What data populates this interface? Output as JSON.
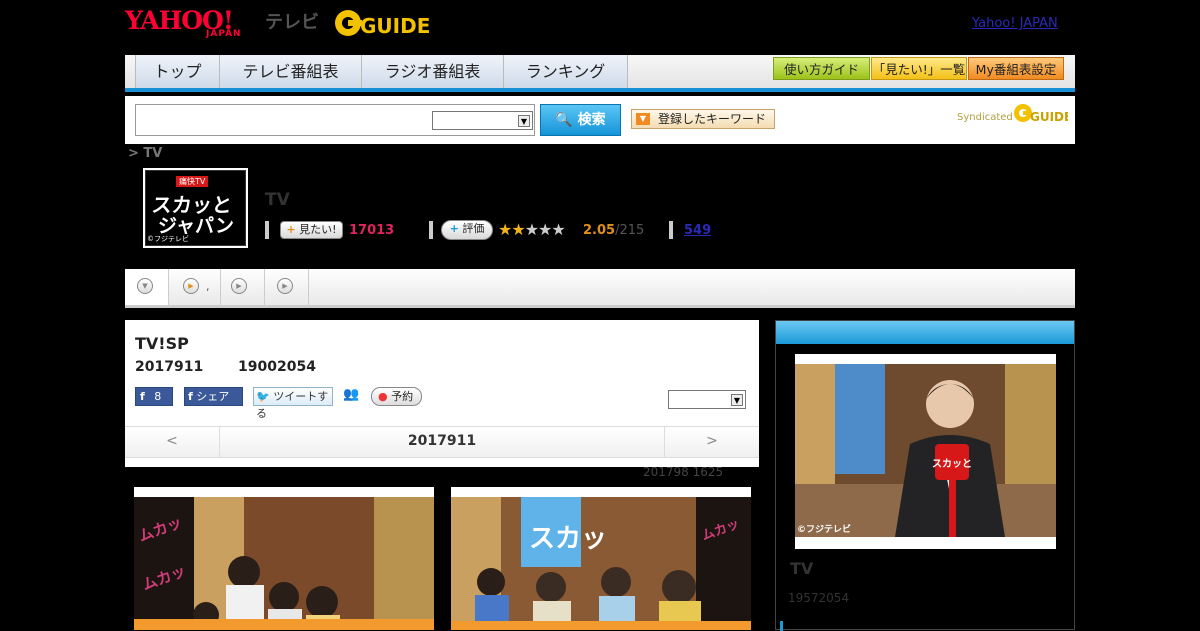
{
  "header": {
    "yahoo_logo": "YAHOO!",
    "japan_logo": "JAPAN",
    "tv_label": "テレビ",
    "gguide_logo": "GUIDE",
    "yahoo_japan_link": "Yahoo! JAPAN"
  },
  "nav": {
    "tabs": [
      "トップ",
      "テレビ番組表",
      "ラジオ番組表",
      "ランキング"
    ],
    "guide_button": "使い方ガイド",
    "mitai_list_button": "「見たい!」一覧",
    "my_settings_button": "My番組表設定"
  },
  "search": {
    "input_value": "",
    "button_label": "検索",
    "keyword_button": "登録したキーワード",
    "syndicated_label": "Syndicated"
  },
  "breadcrumb": "> TV",
  "program": {
    "thumb_badge": "痛快TV",
    "thumb_line1": "スカッと",
    "thumb_line2": "ジャパン",
    "thumb_credit": "©フジテレビ",
    "name": "TV",
    "mitai_button": "見たい!",
    "mitai_count": "17013",
    "rate_button": "評価",
    "rating_value": "2.05",
    "rating_count": "/215",
    "stars_filled": 2,
    "stars_total": 5,
    "review_count": "549"
  },
  "subtabs": [
    ",",
    ""
  ],
  "episode": {
    "title": "TV!SP",
    "date": "2017911",
    "time": "19002054",
    "fb_like_count": "8",
    "fb_share_label": "シェア",
    "tweet_label": "ツイートする",
    "reserve_label": "予約",
    "pager_prev": "<",
    "pager_date": "2017911",
    "pager_next": ">",
    "update_note": "201798  1625"
  },
  "sidebar": {
    "photo_credit": "©フジテレビ",
    "sign_text": "スカッと",
    "title": "TV",
    "number": "19572054"
  },
  "photos": {
    "left_banner": "ムカッ",
    "right_banner": "スカッ"
  }
}
